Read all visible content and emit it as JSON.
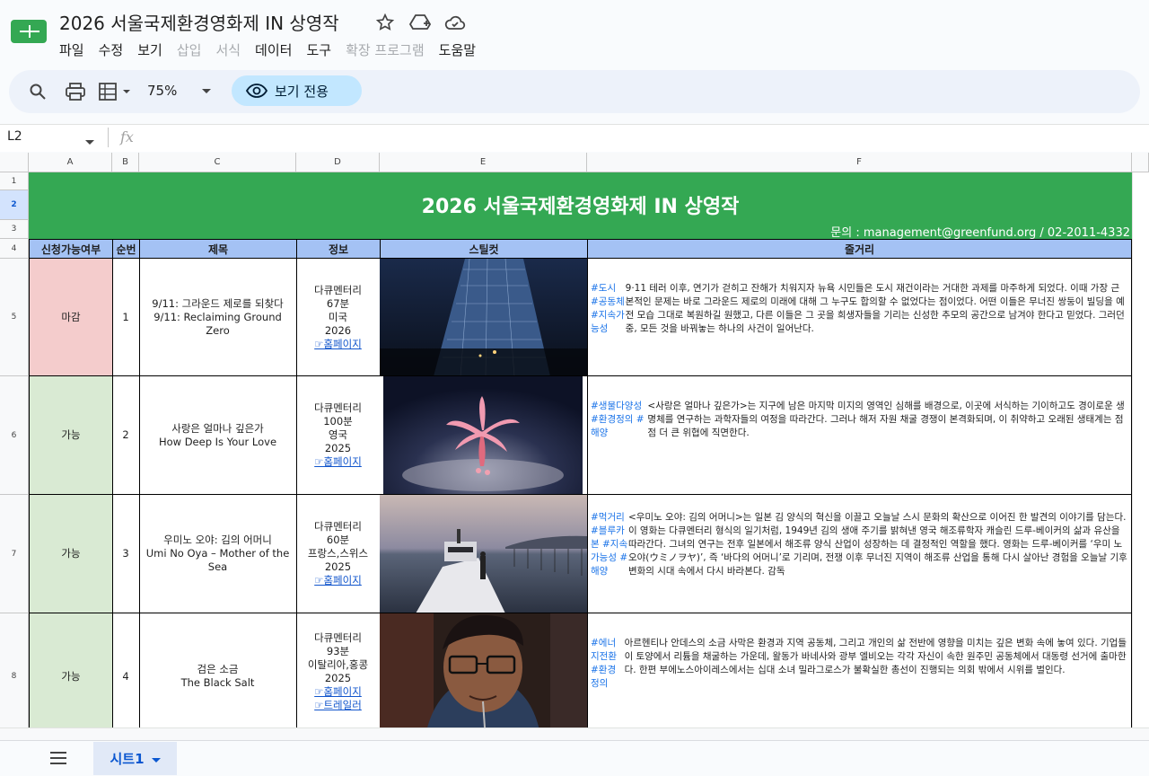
{
  "app": {
    "doc_title": "2026 서울국제환경영화제 IN 상영작",
    "menu": [
      {
        "label": "파일",
        "enabled": true
      },
      {
        "label": "수정",
        "enabled": true
      },
      {
        "label": "보기",
        "enabled": true
      },
      {
        "label": "삽입",
        "enabled": false
      },
      {
        "label": "서식",
        "enabled": false
      },
      {
        "label": "데이터",
        "enabled": true
      },
      {
        "label": "도구",
        "enabled": true
      },
      {
        "label": "확장 프로그램",
        "enabled": false
      },
      {
        "label": "도움말",
        "enabled": true
      }
    ],
    "toolbar": {
      "zoom": "75%",
      "view_only_label": "보기 전용"
    },
    "formula_bar": {
      "name_box": "L2",
      "fx_label": "fx"
    },
    "colors": {
      "banner_green": "#34a853",
      "header_blue": "#a4c2f4",
      "closed_red": "#f4cccc",
      "available_green": "#d9ead3",
      "accent_blue": "#0b57d0"
    }
  },
  "grid": {
    "columns": [
      "A",
      "B",
      "C",
      "D",
      "E",
      "F"
    ],
    "rows": [
      "1",
      "2",
      "3",
      "4",
      "5",
      "6",
      "7",
      "8"
    ],
    "banner": {
      "title": "2026 서울국제환경영화제 IN 상영작",
      "contact": "문의 : management@greenfund.org  /  02-2011-4332"
    },
    "headers": {
      "status": "신청가능여부",
      "order": "순번",
      "title": "제목",
      "info": "정보",
      "still": "스틸컷",
      "synopsis": "줄거리"
    },
    "films": [
      {
        "status": "마감",
        "order": "1",
        "title_ko": "9/11: 그라운드 제로를 되찾다",
        "title_en": "9/11: Reclaiming Ground Zero",
        "info": [
          "다큐멘터리",
          "67분",
          "미국",
          "2026"
        ],
        "links": [
          "☞홈페이지"
        ],
        "tags": "#도시 #공동체 #지속가능성",
        "synopsis": "9·11 테러 이후, 연기가 걷히고 잔해가 치워지자 뉴욕 시민들은 도시 재건이라는 거대한 과제를 마주하게 되었다. 이때 가장 근본적인 문제는 바로 그라운드 제로의 미래에 대해 그 누구도 합의할 수 없었다는 점이었다. 어떤 이들은 무너진 쌍둥이 빌딩을 예전 모습 그대로 복원하길 원했고, 다른 이들은 그 곳을 희생자들을 기리는 신성한 추모의 공간으로 남겨야 한다고 믿었다. 그러던 중, 모든 것을 바꿔놓는 하나의 사건이 일어난다."
      },
      {
        "status": "가능",
        "order": "2",
        "title_ko": "사랑은 얼마나 깊은가",
        "title_en": "How Deep Is Your Love",
        "info": [
          "다큐멘터리",
          "100분",
          "영국",
          "2025"
        ],
        "links": [
          "☞홈페이지"
        ],
        "tags": "#생물다양성 #환경정의 #해양",
        "synopsis": "<사랑은 얼마나 깊은가>는 지구에 남은 마지막 미지의 영역인 심해를 배경으로, 이곳에 서식하는 기이하고도 경이로운 생명체를 연구하는 과학자들의 여정을 따라간다. 그러나 해저 자원 채굴 경쟁이 본격화되며, 이 취약하고 오래된 생태계는 점점 더 큰 위협에 직면한다."
      },
      {
        "status": "가능",
        "order": "3",
        "title_ko": "우미노 오야: 김의 어머니",
        "title_en": "Umi No Oya – Mother of the Sea",
        "info": [
          "다큐멘터리",
          "60분",
          "프랑스,스위스",
          "2025"
        ],
        "links": [
          "☞홈페이지"
        ],
        "tags": "#먹거리 #블루카본 #지속가능성 #해양",
        "synopsis": "<우미노 오야: 김의 어머니>는 일본 김 양식의 혁신을 이끌고 오늘날 스시 문화의 확산으로 이어진 한 발견의 이야기를 담는다. 이 영화는 다큐멘터리 형식의 일기처럼, 1949년 김의 생애 주기를 밝혀낸 영국 해조류학자 캐슬린 드루-베이커의 삶과 유산을 따라간다. 그녀의 연구는 전후 일본에서 해조류 양식 산업이 성장하는 데 결정적인 역할을 했다. 영화는 드루-베이커를 ‘우미 노 오야(ウミノヲヤ)’, 즉 ‘바다의 어머니’로 기리며, 전쟁 이후 무너진 지역이 해조류 산업을 통해 다시 살아난 경험을 오늘날 기후변화의 시대 속에서 다시 바라본다. 감독"
      },
      {
        "status": "가능",
        "order": "4",
        "title_ko": "검은 소금",
        "title_en": "The Black Salt",
        "info": [
          "다큐멘터리",
          "93분",
          "이탈리아,홍콩",
          "2025"
        ],
        "links": [
          "☞홈페이지",
          "☞트레일러"
        ],
        "tags": "#에너지전환 #환경정의",
        "synopsis": "아르헨티나 안데스의 소금 사막은 환경과 지역 공동체, 그리고 개인의 삶 전반에 영향을 미치는 깊은 변화 속에 놓여 있다. 기업들이 토양에서 리튬을 채굴하는 가운데, 왈동가 바네사와 광부 엘비오는 각각 자신이 속한 원주민 공동체에서 대동령 선거에 출마한다. 한편 부에노스아이레스에서는 십대 소녀 밀라그로스가 불확실한 총선이 진행되는 의회 밖에서 시위를 벌인다."
      }
    ]
  },
  "sheets": {
    "active_tab": "시트1"
  }
}
